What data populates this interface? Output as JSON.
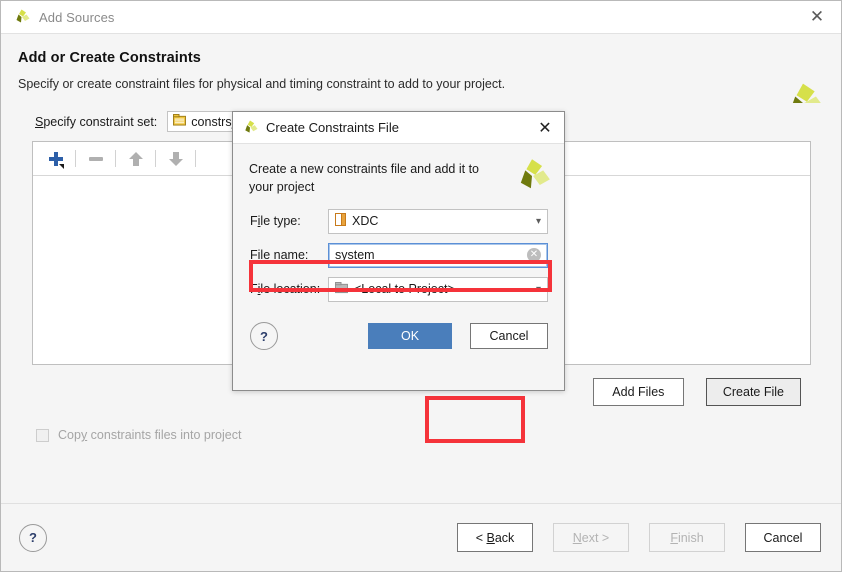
{
  "window": {
    "title": "Add Sources",
    "close_icon": "close-icon",
    "logo_icon": "xilinx-logo-icon"
  },
  "header": {
    "title": "Add or Create Constraints",
    "subtitle": "Specify or create constraint files for physical and timing constraint to add to your project.",
    "logo_icon": "xilinx-logo-icon"
  },
  "constraint_set": {
    "label_prefix": "S",
    "label_rest": "pecify constraint set:",
    "value": "constrs_",
    "icon": "constraint-set-folder-icon"
  },
  "toolbar": {
    "add_icon": "plus-icon",
    "remove_icon": "minus-icon",
    "move_up_icon": "arrow-up-icon",
    "move_down_icon": "arrow-down-icon"
  },
  "actions": {
    "add_files": "Add Files",
    "create_file": "Create File"
  },
  "copy_option": {
    "label_a": "Cop",
    "label_mn": "y",
    "label_b": " constraints files into project",
    "checked": false
  },
  "footer": {
    "help_icon": "help-icon",
    "help_label": "?",
    "buttons": [
      {
        "name": "back-button",
        "pre": "< ",
        "mn": "B",
        "post": "ack",
        "disabled": false
      },
      {
        "name": "next-button",
        "pre": "",
        "mn": "N",
        "post": "ext >",
        "disabled": true
      },
      {
        "name": "finish-button",
        "pre": "",
        "mn": "F",
        "post": "inish",
        "disabled": true
      },
      {
        "name": "cancel-button",
        "pre": "",
        "mn": "",
        "post": "Cancel",
        "disabled": false
      }
    ]
  },
  "modal": {
    "title": "Create Constraints File",
    "close_icon": "close-icon",
    "logo_icon": "xilinx-logo-icon",
    "description": "Create a new constraints file and add it to your project",
    "fields": {
      "file_type": {
        "label_a": "F",
        "label_mn": "i",
        "label_b": "le type:",
        "value": "XDC",
        "icon": "xdc-file-icon",
        "chevron": "chevron-down-icon"
      },
      "file_name": {
        "label_a": "F",
        "label_mn": "i",
        "label_b": "le name:",
        "value": "system",
        "placeholder": "",
        "clear_icon": "clear-icon",
        "focused": true
      },
      "file_location": {
        "label_a": "F",
        "label_mn": "i",
        "label_b": "le location:",
        "value": "<Local to Project>",
        "icon": "folder-location-icon",
        "chevron": "chevron-down-icon"
      }
    },
    "help_label": "?",
    "ok_label": "OK",
    "cancel_label": "Cancel"
  },
  "colors": {
    "accent_blue": "#4a7ebb",
    "annotation_red": "#f5333a",
    "logo_dark": "#6f7a0e",
    "logo_mid": "#d6e04a",
    "logo_light": "#e2ea8c"
  }
}
